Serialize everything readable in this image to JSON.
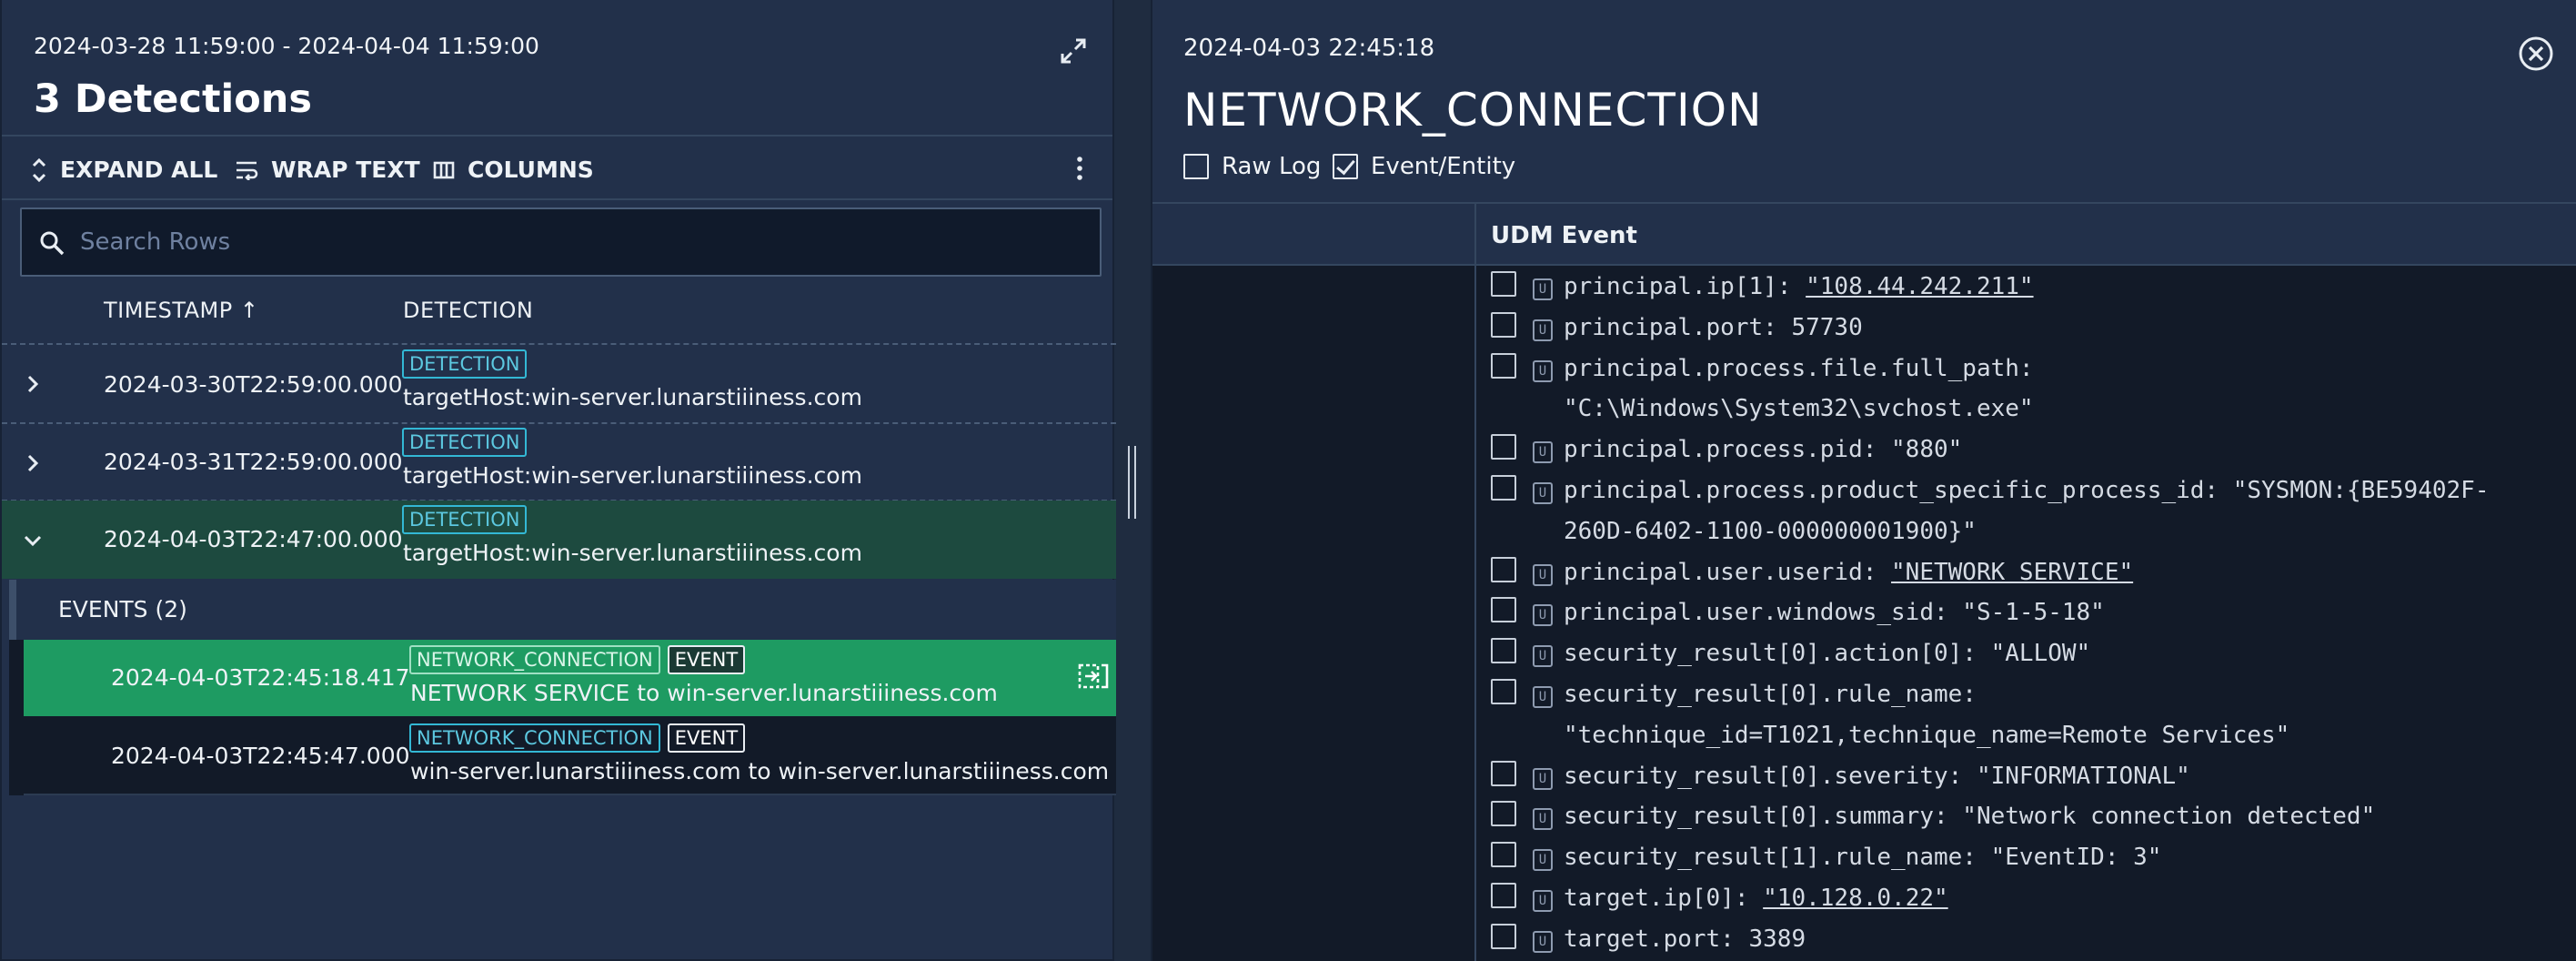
{
  "left_panel": {
    "date_range": "2024-03-28 11:59:00 - 2024-04-04 11:59:00",
    "title": "3 Detections",
    "toolbar": {
      "expand_all": "EXPAND ALL",
      "wrap_text": "WRAP TEXT",
      "columns": "COLUMNS"
    },
    "search_placeholder": "Search Rows",
    "columns": {
      "timestamp": "TIMESTAMP ↑",
      "detection": "DETECTION"
    },
    "rows": [
      {
        "timestamp": "2024-03-30T22:59:00.000",
        "badge": "DETECTION",
        "target": "targetHost:win-server.lunarstiiiness.com"
      },
      {
        "timestamp": "2024-03-31T22:59:00.000",
        "badge": "DETECTION",
        "target": "targetHost:win-server.lunarstiiiness.com"
      },
      {
        "timestamp": "2024-04-03T22:47:00.000",
        "badge": "DETECTION",
        "target": "targetHost:win-server.lunarstiiiness.com"
      }
    ],
    "events_label": "EVENTS (2)",
    "events": [
      {
        "timestamp": "2024-04-03T22:45:18.417",
        "badge1": "NETWORK_CONNECTION",
        "badge2": "EVENT",
        "description": "NETWORK SERVICE to win-server.lunarstiiiness.com"
      },
      {
        "timestamp": "2024-04-03T22:45:47.000",
        "badge1": "NETWORK_CONNECTION",
        "badge2": "EVENT",
        "description": "win-server.lunarstiiiness.com to win-server.lunarstiiiness.com"
      }
    ]
  },
  "right_panel": {
    "timestamp": "2024-04-03 22:45:18",
    "title": "NETWORK_CONNECTION",
    "raw_log_label": "Raw Log",
    "event_entity_label": "Event/Entity",
    "udm_header": "UDM Event",
    "field_badge": "U",
    "fields": [
      {
        "key": "principal.ip[1]: ",
        "value": "\"108.44.242.211\"",
        "link": true
      },
      {
        "key": "principal.port: ",
        "value": "57730",
        "link": false
      },
      {
        "key": "principal.process.file.full_path:",
        "value": "",
        "link": false,
        "cont": "\"C:\\Windows\\System32\\svchost.exe\""
      },
      {
        "key": "principal.process.pid: ",
        "value": "\"880\"",
        "link": false
      },
      {
        "key": "principal.process.product_specific_process_id: ",
        "value": "\"SYSMON:{BE59402F-",
        "link": false,
        "cont": "260D-6402-1100-000000001900}\""
      },
      {
        "key": "principal.user.userid: ",
        "value": "\"NETWORK SERVICE\"",
        "link": true
      },
      {
        "key": "principal.user.windows_sid: ",
        "value": "\"S-1-5-18\"",
        "link": false
      },
      {
        "key": "security_result[0].action[0]: ",
        "value": "\"ALLOW\"",
        "link": false
      },
      {
        "key": "security_result[0].rule_name:",
        "value": "",
        "link": false,
        "cont": "\"technique_id=T1021,technique_name=Remote Services\""
      },
      {
        "key": "security_result[0].severity: ",
        "value": "\"INFORMATIONAL\"",
        "link": false
      },
      {
        "key": "security_result[0].summary: ",
        "value": "\"Network connection detected\"",
        "link": false
      },
      {
        "key": "security_result[1].rule_name: ",
        "value": "\"EventID: 3\"",
        "link": false
      },
      {
        "key": "target.ip[0]: ",
        "value": "\"10.128.0.22\"",
        "link": true
      },
      {
        "key": "target.port: ",
        "value": "3389",
        "link": false
      }
    ]
  },
  "colors": {
    "panel_bg": "#22304a",
    "selected_row": "#1d4a3f",
    "active_event": "#1e9b62",
    "badge_accent": "#33b8d5"
  }
}
